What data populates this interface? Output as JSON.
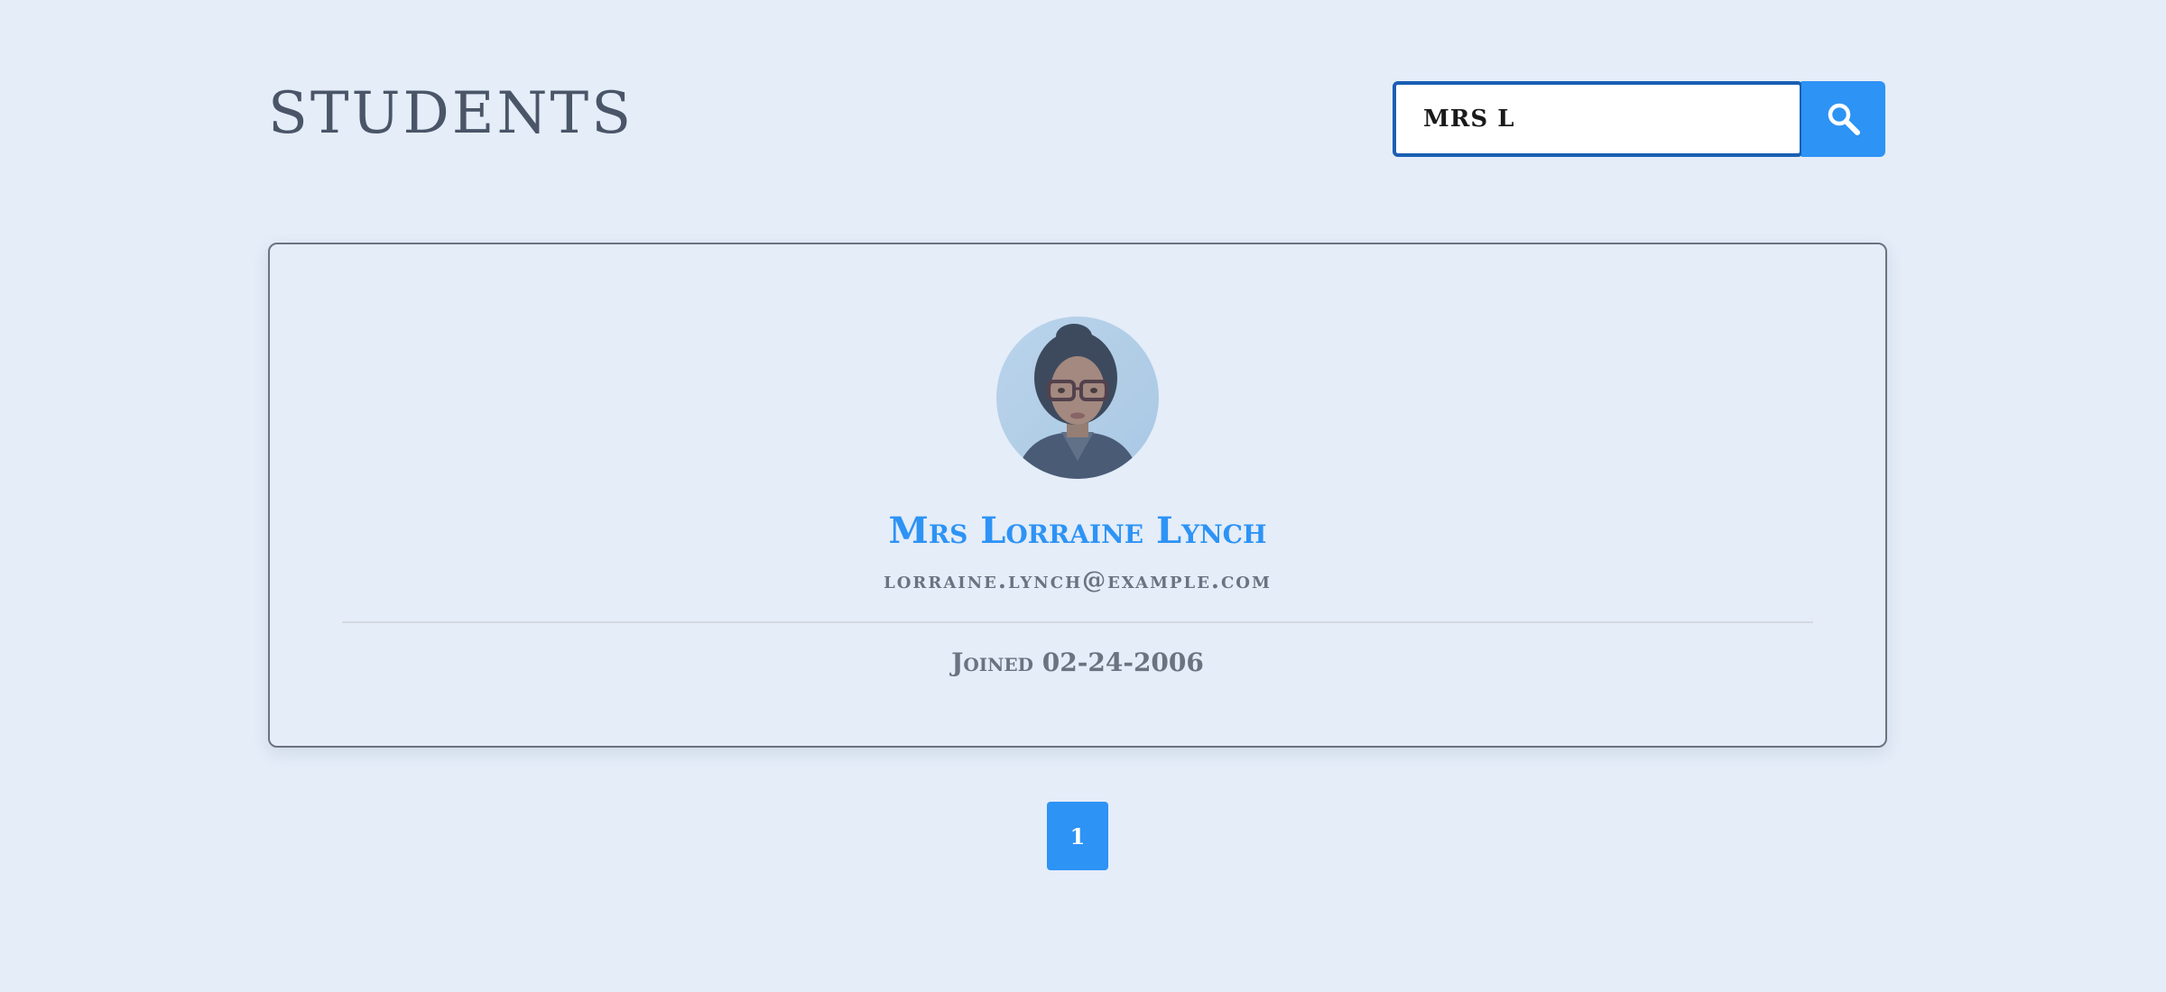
{
  "header": {
    "title": "STUDENTS"
  },
  "search": {
    "value": "MRS L",
    "icon": "search-icon",
    "button_color": "#2d93f5"
  },
  "student": {
    "name": "Mrs Lorraine Lynch",
    "email": "lorraine.lynch@example.com",
    "joined": "Joined 02-24-2006"
  },
  "pagination": {
    "pages": [
      "1"
    ],
    "current": "1"
  },
  "colors": {
    "background": "#e4edf8",
    "accent": "#2d93f5",
    "text": "#4a5568"
  }
}
